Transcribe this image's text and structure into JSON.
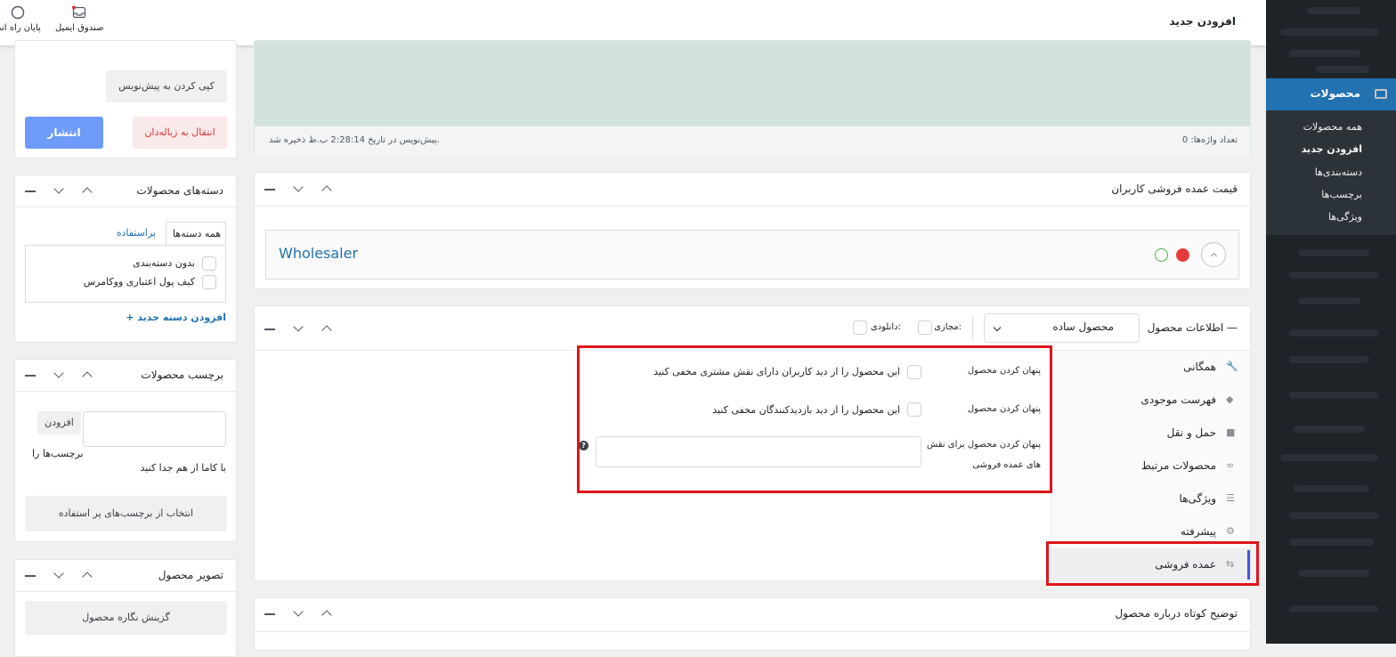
{
  "admin_menu": {
    "products": {
      "label": "محصولات",
      "items": [
        {
          "label": "همه محصولات",
          "current": false
        },
        {
          "label": "افزودن جدید",
          "current": true
        },
        {
          "label": "دسته‌بندی‌ها",
          "current": false
        },
        {
          "label": "برچسب‌ها",
          "current": false
        },
        {
          "label": "ویژگی‌ها",
          "current": false
        }
      ]
    }
  },
  "topbar": {
    "page_title": "افزودن جدید",
    "email_box": "صندوق ایمیل",
    "end_setup": "پایان راه اندا"
  },
  "editor_footer": {
    "word_count": "تعداد واژه‌ها: 0",
    "autosave": "پیش‌نویس در تاریخ 2:28:14 ب.ظ ذخیره شد."
  },
  "wholesale_price_box": {
    "title": "قیمت عمده فروشی کاربران",
    "role": "Wholesaler"
  },
  "product_data": {
    "title": "اطلاعات محصول —",
    "type_select": "محصول ساده",
    "virtual_label": "مجازی:",
    "downloadable_label": "دانلودی:",
    "tabs": [
      {
        "label": "همگانی",
        "icon": "wrench-icon"
      },
      {
        "label": "فهرست موجودی",
        "icon": "tag-icon"
      },
      {
        "label": "حمل و نقل",
        "icon": "truck-icon"
      },
      {
        "label": "محصولات مرتبط",
        "icon": "link-icon"
      },
      {
        "label": "ویژگی‌ها",
        "icon": "list-icon"
      },
      {
        "label": "پیشرفته",
        "icon": "gear-icon"
      },
      {
        "label": "عمده فروشی",
        "icon": "wholesale-icon"
      }
    ],
    "fields": {
      "hide_customer_label": "پنهان کردن محصول",
      "hide_customer_desc": "این محصول را از دید کاربران دارای نقش مشتری مخفی کنید",
      "hide_visitor_label": "پنهان کردن محصول",
      "hide_visitor_desc": "این محصول را از دید بازدیدکنندگان مخفی کنید",
      "hide_roles_label_1": "پنهان کردن محصول برای نقش",
      "hide_roles_label_2": "های عمده فروشی",
      "help": "?"
    }
  },
  "short_description": {
    "title": "توضیح کوتاه درباره محصول"
  },
  "publish": {
    "copy_draft": "کپی کردن به پیش‌نویس",
    "trash": "انتقال به زباله‌دان",
    "publish": "انتشار"
  },
  "categories": {
    "title": "دسته‌های محصولات",
    "tab_all": "همه دسته‌ها",
    "tab_popular": "پراستفاده",
    "items": [
      "بدون دسته‌بندی",
      "کیف پول اعتباری ووکامرس"
    ],
    "add_new": "+ افزودن دسته جدید"
  },
  "tags": {
    "title": "برچسب محصولات",
    "add": "افزودن",
    "hint_1": "برچسب‌ها را",
    "hint_2": "با کاما از هم جدا کنید",
    "choose": "انتخاب از برچسب‌های پر استفاده"
  },
  "image": {
    "title": "تصویر محصول",
    "set": "گزینش نگاره محصول"
  },
  "colors": {
    "highlight": "#e0151b",
    "publish": "#6e9bf9",
    "link": "#2271b1"
  }
}
